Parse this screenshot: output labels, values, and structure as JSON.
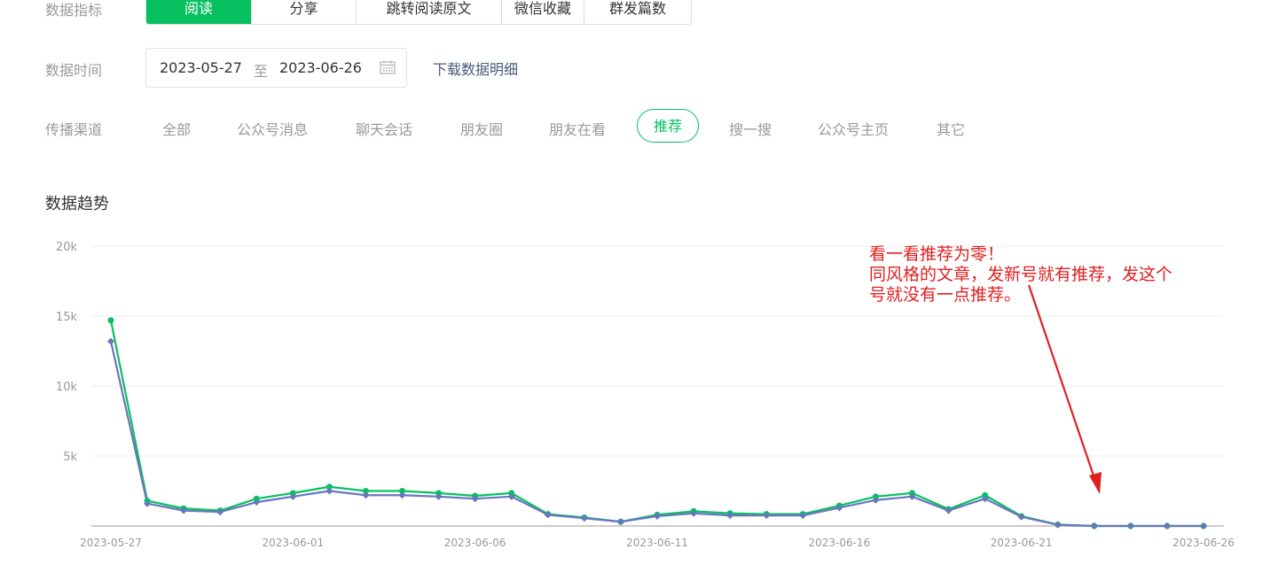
{
  "filters": {
    "metric_label": "数据指标",
    "metric_tabs": [
      {
        "label": "阅读",
        "active": true
      },
      {
        "label": "分享",
        "active": false
      },
      {
        "label": "跳转阅读原文",
        "active": false
      },
      {
        "label": "微信收藏",
        "active": false
      },
      {
        "label": "群发篇数",
        "active": false
      }
    ],
    "time_label": "数据时间",
    "date_start": "2023-05-27",
    "date_separator": "至",
    "date_end": "2023-06-26",
    "download_label": "下载数据明细",
    "channel_label": "传播渠道",
    "channels": [
      {
        "label": "全部",
        "active": false
      },
      {
        "label": "公众号消息",
        "active": false
      },
      {
        "label": "聊天会话",
        "active": false
      },
      {
        "label": "朋友圈",
        "active": false
      },
      {
        "label": "朋友在看",
        "active": false
      },
      {
        "label": "推荐",
        "active": true
      },
      {
        "label": "搜一搜",
        "active": false
      },
      {
        "label": "公众号主页",
        "active": false
      },
      {
        "label": "其它",
        "active": false
      }
    ]
  },
  "section_title": "数据趋势",
  "annotation": {
    "lines": [
      "看一看推荐为零！",
      "同风格的文章，发新号就有推荐，发这个",
      "号就没有一点推荐。"
    ],
    "color": "#e02020"
  },
  "colors": {
    "accent": "#07c160",
    "series2": "#6a75c0",
    "annotation": "#e02020"
  },
  "chart_data": {
    "type": "line",
    "x": [
      "2023-05-27",
      "2023-05-28",
      "2023-05-29",
      "2023-05-30",
      "2023-05-31",
      "2023-06-01",
      "2023-06-02",
      "2023-06-03",
      "2023-06-04",
      "2023-06-05",
      "2023-06-06",
      "2023-06-07",
      "2023-06-08",
      "2023-06-09",
      "2023-06-10",
      "2023-06-11",
      "2023-06-12",
      "2023-06-13",
      "2023-06-14",
      "2023-06-15",
      "2023-06-16",
      "2023-06-17",
      "2023-06-18",
      "2023-06-19",
      "2023-06-20",
      "2023-06-21",
      "2023-06-22",
      "2023-06-23",
      "2023-06-24",
      "2023-06-25",
      "2023-06-26"
    ],
    "x_tick_labels": [
      "2023-05-27",
      "2023-06-01",
      "2023-06-06",
      "2023-06-11",
      "2023-06-16",
      "2023-06-21",
      "2023-06-26"
    ],
    "y_tick_labels": [
      "20k",
      "15k",
      "10k",
      "5k"
    ],
    "ylim": [
      0,
      20000
    ],
    "grid": true,
    "series": [
      {
        "color": "#07c160",
        "marker": "circle",
        "values": [
          14700,
          1800,
          1250,
          1100,
          1950,
          2350,
          2800,
          2500,
          2500,
          2350,
          2150,
          2350,
          850,
          600,
          300,
          800,
          1050,
          900,
          850,
          850,
          1450,
          2100,
          2350,
          1200,
          2200,
          700,
          100,
          0,
          0,
          0,
          0
        ]
      },
      {
        "color": "#6a75c0",
        "marker": "diamond",
        "values": [
          13200,
          1600,
          1100,
          1000,
          1700,
          2100,
          2500,
          2200,
          2200,
          2100,
          1950,
          2100,
          800,
          550,
          300,
          700,
          900,
          750,
          750,
          750,
          1300,
          1850,
          2100,
          1100,
          1950,
          650,
          80,
          0,
          0,
          0,
          0
        ]
      }
    ]
  }
}
